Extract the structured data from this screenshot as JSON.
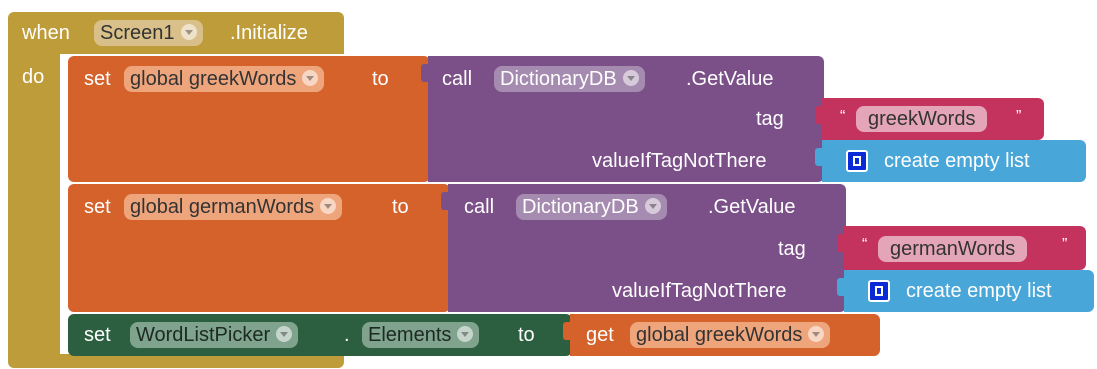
{
  "colors": {
    "event": "#bf9c3a",
    "event_dark": "#a68628",
    "variable": "#d5612b",
    "procedure": "#7b4f87",
    "text": "#c3335e",
    "list": "#49a6d8",
    "component_set": "#2b5f3f"
  },
  "event_block": {
    "when_label": "when",
    "component": "Screen1",
    "event_name": ".Initialize",
    "do_label": "do"
  },
  "set_greek": {
    "set_label": "set",
    "variable": "global greekWords",
    "to_label": "to",
    "call_label": "call",
    "component": "DictionaryDB",
    "method": ".GetValue",
    "tag_label": "tag",
    "tag_value": "greekWords",
    "value_label": "valueIfTagNotThere",
    "list_label": "create empty list",
    "list_icon": "list-icon"
  },
  "set_german": {
    "set_label": "set",
    "variable": "global germanWords",
    "to_label": "to",
    "call_label": "call",
    "component": "DictionaryDB",
    "method": ".GetValue",
    "tag_label": "tag",
    "tag_value": "germanWords",
    "value_label": "valueIfTagNotThere",
    "list_label": "create empty list",
    "list_icon": "list-icon"
  },
  "set_elements": {
    "set_label": "set",
    "component": "WordListPicker",
    "dot": ".",
    "property": "Elements",
    "to_label": "to",
    "get_label": "get",
    "variable": "global greekWords"
  }
}
